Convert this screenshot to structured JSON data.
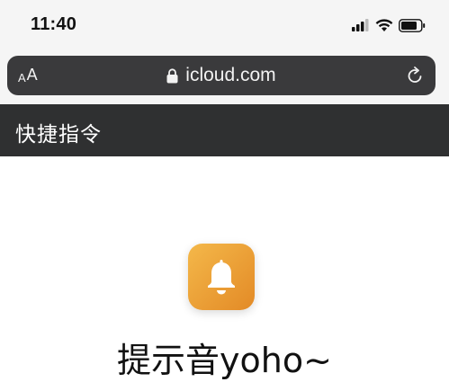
{
  "status_bar": {
    "time": "11:40",
    "icons": [
      "cellular-signal-icon",
      "wifi-icon",
      "battery-icon"
    ]
  },
  "browser": {
    "text_size_label_small": "A",
    "text_size_label_large": "A",
    "url": "icloud.com",
    "icons": [
      "lock-icon",
      "reload-icon"
    ]
  },
  "app_header": {
    "title": "快捷指令"
  },
  "shortcut": {
    "name": "提示音yoho~",
    "icon": "bell-icon",
    "colors": {
      "gradient_start": "#f4b84a",
      "gradient_end": "#e38a26"
    }
  }
}
